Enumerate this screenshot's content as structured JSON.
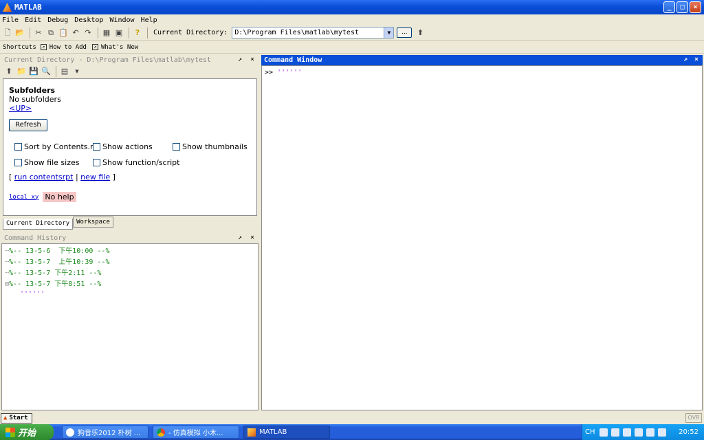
{
  "window": {
    "title": "MATLAB",
    "min": "_",
    "max": "□",
    "close": "×"
  },
  "menu": [
    "File",
    "Edit",
    "Debug",
    "Desktop",
    "Window",
    "Help"
  ],
  "toolbar": {
    "current_directory_label": "Current Directory:",
    "current_directory_value": "D:\\Program Files\\matlab\\mytest",
    "browse_label": "..."
  },
  "shortcuts": {
    "label": "Shortcuts",
    "items": [
      "How to Add",
      "What's New"
    ]
  },
  "current_directory_panel": {
    "title": "Current Directory - D:\\Program Files\\matlab\\mytest",
    "undock": "↗",
    "close": "×",
    "subfolders_heading": "Subfolders",
    "no_subfolders": "No subfolders",
    "up_link": "<UP>",
    "refresh": "Refresh",
    "options": {
      "sort_by_contents": "Sort by Contents.m",
      "show_actions": "Show actions",
      "show_thumbnails": "Show thumbnails",
      "show_file_sizes": "Show file sizes",
      "show_function_script": "Show function/script"
    },
    "bracket_open": "[",
    "run_contentsrpt": "run contentsrpt",
    "pipe": "|",
    "new_file": "new file",
    "bracket_close": "]",
    "file_name": "local_xy",
    "no_help": "No help",
    "tabs": [
      "Current Directory",
      "Workspace"
    ]
  },
  "command_history": {
    "title": "Command History",
    "undock": "↗",
    "close": "×",
    "entries": [
      {
        "tree": "┈",
        "text": "%-- 13-5-6  下午10:00 --%"
      },
      {
        "tree": "┈",
        "text": "%-- 13-5-7  上午10:39 --%"
      },
      {
        "tree": "┈",
        "text": "%-- 13-5-7 下午2:11 --%"
      },
      {
        "tree": "⊟",
        "text": "%-- 13-5-7 下午8:51 --%"
      }
    ],
    "child": "''''''"
  },
  "command_window": {
    "title": "Command Window",
    "undock": "↗",
    "close": "×",
    "prompt": ">>",
    "input": "''''''"
  },
  "status": {
    "start": "Start",
    "ovr": "OVR"
  },
  "taskbar": {
    "start": "开始",
    "tasks": [
      "狗音乐2012 朴树 ...",
      "- 仿真模拟 小木...",
      "MATLAB"
    ],
    "tray_lang": "CH",
    "clock": "20:52"
  },
  "colors": {
    "titlebar": "#0a4fd8",
    "string": "#a020f0",
    "history": "#1e8a1e",
    "link": "#0000cc",
    "no_help_bg": "#f7c7c7"
  }
}
